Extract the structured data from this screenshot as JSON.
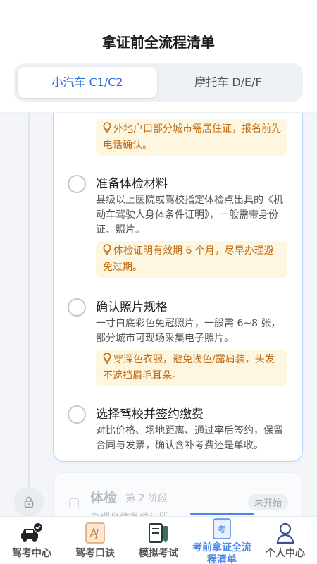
{
  "header": {
    "title": "拿证前全流程清单",
    "segments": [
      {
        "label": "小汽车 C1/C2",
        "active": true
      },
      {
        "label": "摩托车 D/E/F",
        "active": false
      }
    ]
  },
  "current_stage": {
    "top_tip": "外地户口部分城市需居住证，报名前先电话确认。",
    "tasks": [
      {
        "title": "准备体检材料",
        "desc": "县级以上医院或驾校指定体检点出具的《机动车驾驶人身体条件证明》，一般需带身份证、照片。",
        "tip": "体检证明有效期 6 个月，尽早办理避免过期。",
        "checked": false
      },
      {
        "title": "确认照片规格",
        "desc": "一寸白底彩色免冠照片，一般需 6~8 张，部分城市可现场采集电子照片。",
        "tip": "穿深色衣服，避免浅色/露肩装，头发不遮挡眉毛耳朵。",
        "checked": false
      },
      {
        "title": "选择驾校并签约缴费",
        "desc": "对比价格、场地距离、通过率后签约，保留合同与发票，确认含补考费还是单收。",
        "checked": false
      }
    ]
  },
  "next_stage": {
    "name": "体检",
    "phase": "第 2 阶段",
    "desc": "办理身体条件证明",
    "status": "未开始"
  },
  "tabbar": {
    "items": [
      {
        "label": "驾考中心",
        "icon": "car-check-icon",
        "active": false
      },
      {
        "label": "驾考口诀",
        "icon": "formula-book-icon",
        "active": false
      },
      {
        "label": "模拟考试",
        "icon": "exam-book-icon",
        "active": false
      },
      {
        "label": "考前拿证全流程清单",
        "icon": "exam-checklist-icon",
        "active": true,
        "icon_text": "考"
      },
      {
        "label": "个人中心",
        "icon": "person-icon",
        "active": false
      }
    ]
  },
  "colors": {
    "accent": "#2f6fd8",
    "tab_active": "#4a86e8",
    "tip_bg": "#fdf6e0",
    "tip_text": "#c06a12"
  }
}
